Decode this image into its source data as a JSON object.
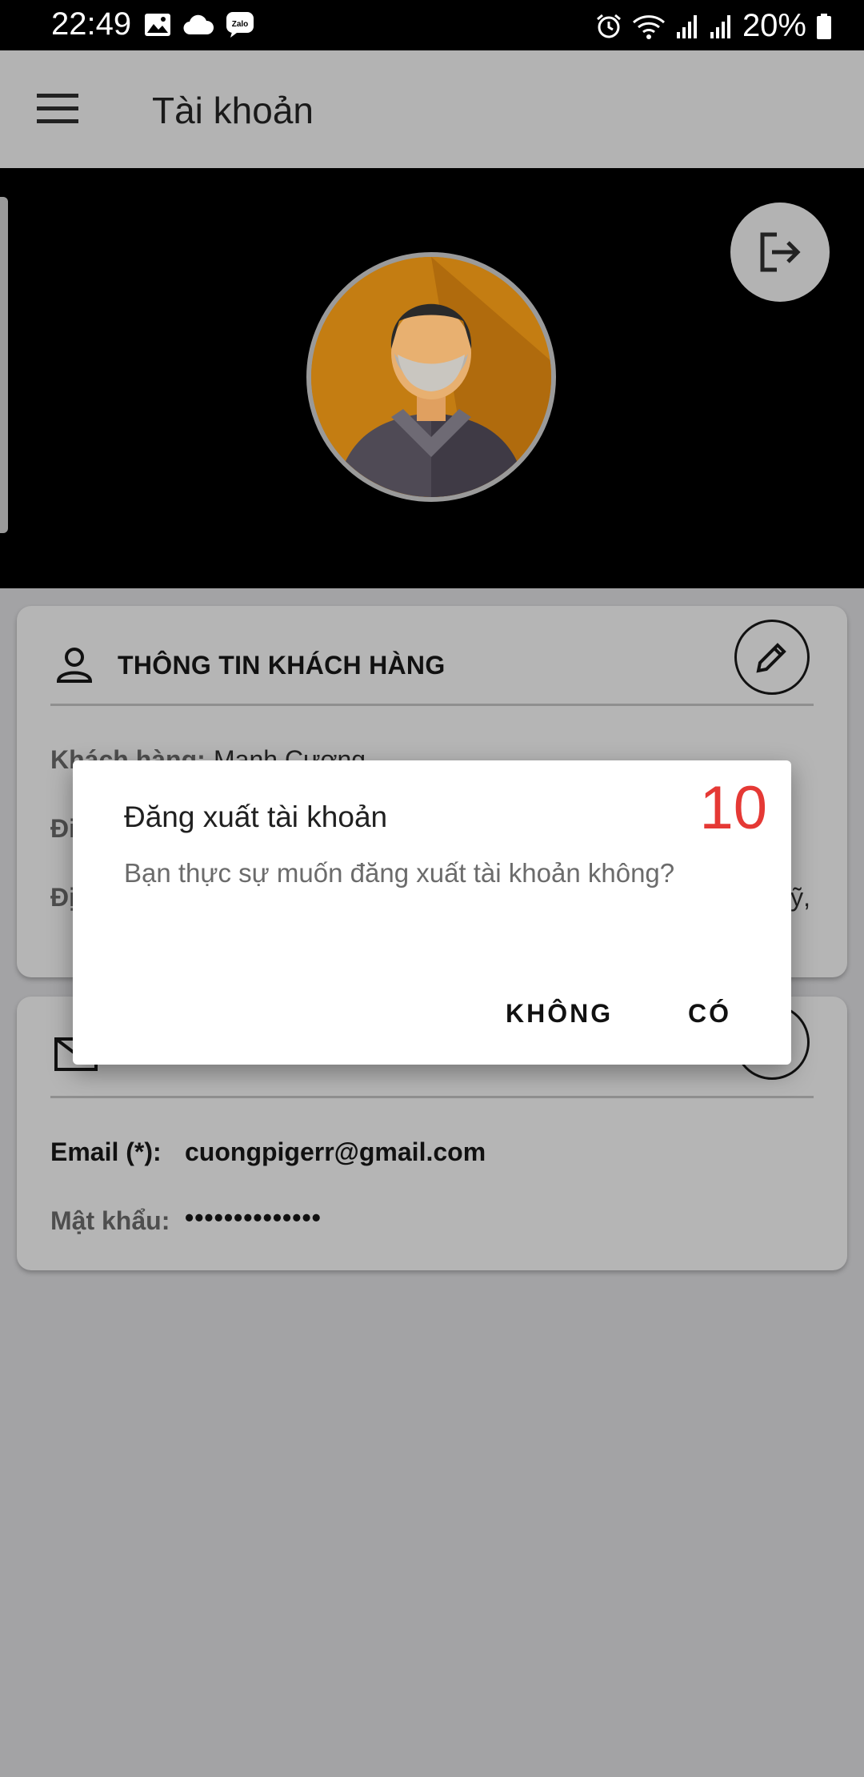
{
  "status_bar": {
    "time": "22:49",
    "left_icons": [
      "image-icon",
      "cloud-icon",
      "zalo-icon"
    ],
    "zalo_label": "Zalo",
    "right_icons": [
      "alarm-icon",
      "wifi-icon",
      "signal-icon",
      "signal-icon",
      "battery-icon"
    ],
    "battery_percent": "20%"
  },
  "app_bar": {
    "menu_icon": "menu-icon",
    "title": "Tài khoản"
  },
  "header": {
    "logout_icon": "logout-icon",
    "avatar_icon": "avatar-icon"
  },
  "customer_card": {
    "icon": "person-icon",
    "title": "THÔNG TIN KHÁCH HÀNG",
    "edit_icon": "pencil-icon",
    "rows": [
      {
        "label": "Khách hàng:",
        "value": "Mạnh Cương"
      },
      {
        "label": "Đi",
        "value": ""
      },
      {
        "label": "Đị",
        "value": "lỹ,"
      }
    ]
  },
  "account_card": {
    "icon": "mail-icon",
    "edit_icon": "pencil-icon",
    "email_label": "Email (*):",
    "email_value": "cuongpigerr@gmail.com",
    "password_label": "Mật khẩu:",
    "password_value": "••••••••••••••"
  },
  "dialog": {
    "title": "Đăng xuất tài khoản",
    "counter": "10",
    "message": "Bạn thực sự muốn đăng xuất tài khoản không?",
    "no_label": "KHÔNG",
    "yes_label": "CÓ"
  },
  "colors": {
    "scrim_background": "#a3a3a5",
    "card_background": "#b5b5b5",
    "header_background": "#000000",
    "counter_red": "#e53935",
    "avatar_orange": "#c47d12"
  }
}
